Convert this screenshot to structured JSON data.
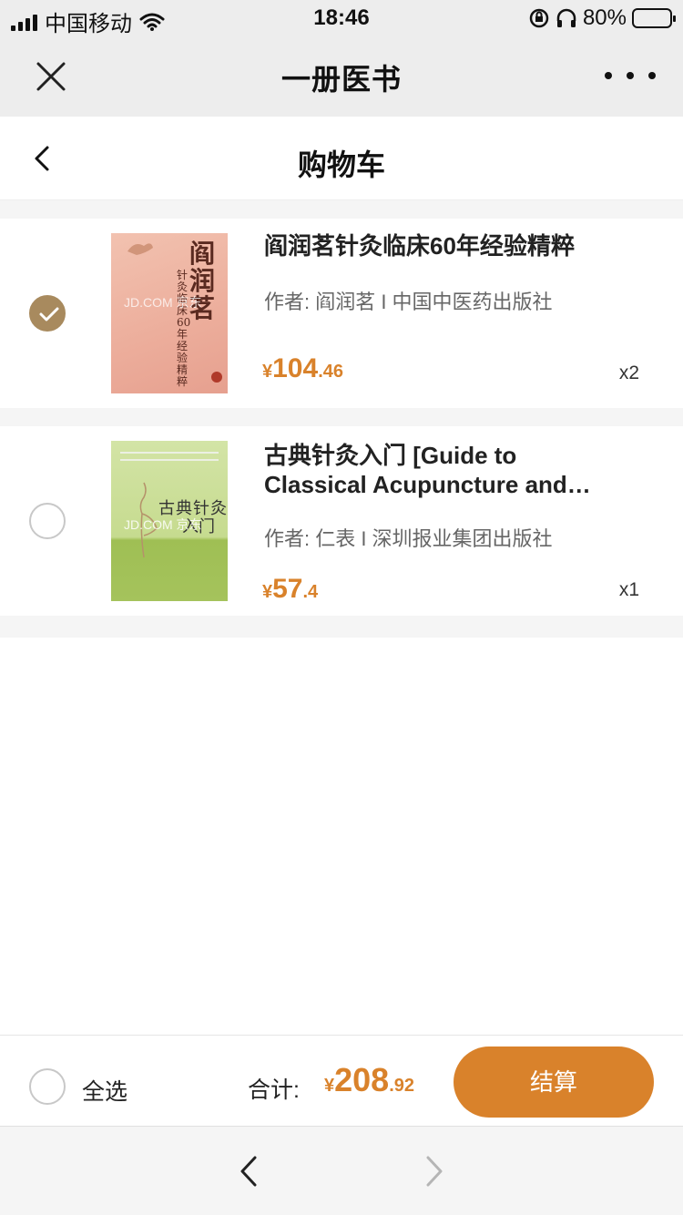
{
  "status_bar": {
    "carrier": "中国移动",
    "time": "18:46",
    "battery_percent": "80%"
  },
  "nav": {
    "title": "一册医书",
    "close_icon": "close-icon",
    "more_icon": "more-icon"
  },
  "header": {
    "title": "购物车",
    "back_icon": "back-icon"
  },
  "cart": {
    "items": [
      {
        "checked": true,
        "title": "阎润茗针灸临床60年经验精粹",
        "meta": "作者: 阎润茗 I 中国中医药出版社",
        "price_currency": "¥",
        "price_int": "104",
        "price_dec": ".46",
        "qty": "x2",
        "cover": {
          "title": "阎润茗",
          "subtitle": "针灸临床60年经验精粹",
          "watermark": "JD.COM 京东"
        }
      },
      {
        "checked": false,
        "title_line1": "古典针灸入门 [Guide to",
        "title_line2": "Classical Acupuncture and…",
        "meta": "作者: 仁表 I 深圳报业集团出版社",
        "price_currency": "¥",
        "price_int": "57",
        "price_dec": ".4",
        "qty": "x1",
        "cover": {
          "title": "古典针灸",
          "title2": "入门",
          "watermark": "JD.COM 京东"
        }
      }
    ]
  },
  "footer": {
    "select_all_label": "全选",
    "total_label": "合计:",
    "total_currency": "¥",
    "total_int": "208",
    "total_dec": ".92",
    "checkout_label": "结算"
  },
  "colors": {
    "accent": "#d9822b",
    "check_on": "#a88a5e",
    "nav_bg": "#ededed"
  }
}
